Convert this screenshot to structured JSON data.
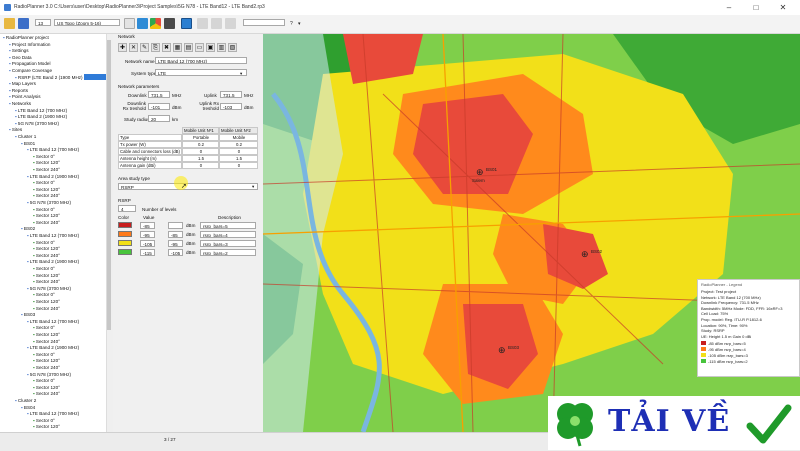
{
  "window": {
    "title": "RadioPlanner 3.0 C:\\Users\\user\\Desktop\\RadioPlanner3\\Project Samples\\5G N78 - LTE Band12 - LTE Band2.rp3"
  },
  "toolbar": {
    "layer_number": "13",
    "basemap": "US Topo (Zoom 5-16)"
  },
  "tree": {
    "items": [
      {
        "label": "RadioPlanner project",
        "indent": 0
      },
      {
        "label": "Project Information",
        "indent": 1
      },
      {
        "label": "Settings",
        "indent": 1
      },
      {
        "label": "Geo Data",
        "indent": 1
      },
      {
        "label": "Propagation Model",
        "indent": 1
      },
      {
        "label": "Compare Coverage",
        "indent": 1
      },
      {
        "label": "RSRP (LTE Band 2 (1900 MHz)",
        "indent": 2
      },
      {
        "label": "Map Layers",
        "indent": 1
      },
      {
        "label": "Reports",
        "indent": 1
      },
      {
        "label": "Point Analysis",
        "indent": 1
      },
      {
        "label": "Networks",
        "indent": 1
      },
      {
        "label": "LTE Band 12 (700 MHz)",
        "indent": 2
      },
      {
        "label": "LTE Band 2 (1900 MHz)",
        "indent": 2
      },
      {
        "label": "5G N78 (3700 MHz)",
        "indent": 2
      },
      {
        "label": "Sites",
        "indent": 1
      },
      {
        "label": "Cluster 1",
        "indent": 2
      },
      {
        "label": "BS01",
        "indent": 3
      },
      {
        "label": "LTE Band 12 (700 MHz)",
        "indent": 4
      },
      {
        "label": "Sector 0°",
        "indent": 5
      },
      {
        "label": "Sector 120°",
        "indent": 5
      },
      {
        "label": "Sector 240°",
        "indent": 5
      },
      {
        "label": "LTE Band 2 (1900 MHz)",
        "indent": 4
      },
      {
        "label": "Sector 0°",
        "indent": 5
      },
      {
        "label": "Sector 120°",
        "indent": 5
      },
      {
        "label": "Sector 240°",
        "indent": 5
      },
      {
        "label": "5G N78 (3700 MHz)",
        "indent": 4
      },
      {
        "label": "Sector 0°",
        "indent": 5
      },
      {
        "label": "Sector 120°",
        "indent": 5
      },
      {
        "label": "Sector 240°",
        "indent": 5
      },
      {
        "label": "BS02",
        "indent": 3
      },
      {
        "label": "LTE Band 12 (700 MHz)",
        "indent": 4
      },
      {
        "label": "Sector 0°",
        "indent": 5
      },
      {
        "label": "Sector 120°",
        "indent": 5
      },
      {
        "label": "Sector 240°",
        "indent": 5
      },
      {
        "label": "LTE Band 2 (1900 MHz)",
        "indent": 4
      },
      {
        "label": "Sector 0°",
        "indent": 5
      },
      {
        "label": "Sector 120°",
        "indent": 5
      },
      {
        "label": "Sector 240°",
        "indent": 5
      },
      {
        "label": "5G N78 (3700 MHz)",
        "indent": 4
      },
      {
        "label": "Sector 0°",
        "indent": 5
      },
      {
        "label": "Sector 120°",
        "indent": 5
      },
      {
        "label": "Sector 240°",
        "indent": 5
      },
      {
        "label": "BS03",
        "indent": 3
      },
      {
        "label": "LTE Band 12 (700 MHz)",
        "indent": 4
      },
      {
        "label": "Sector 0°",
        "indent": 5
      },
      {
        "label": "Sector 120°",
        "indent": 5
      },
      {
        "label": "Sector 240°",
        "indent": 5
      },
      {
        "label": "LTE Band 2 (1900 MHz)",
        "indent": 4
      },
      {
        "label": "Sector 0°",
        "indent": 5
      },
      {
        "label": "Sector 120°",
        "indent": 5
      },
      {
        "label": "Sector 240°",
        "indent": 5
      },
      {
        "label": "5G N78 (3700 MHz)",
        "indent": 4
      },
      {
        "label": "Sector 0°",
        "indent": 5
      },
      {
        "label": "Sector 120°",
        "indent": 5
      },
      {
        "label": "Sector 240°",
        "indent": 5
      },
      {
        "label": "Cluster 2",
        "indent": 2
      },
      {
        "label": "BS04",
        "indent": 3
      },
      {
        "label": "LTE Band 12 (700 MHz)",
        "indent": 4
      },
      {
        "label": "Sector 0°",
        "indent": 5
      },
      {
        "label": "Sector 120°",
        "indent": 5
      }
    ]
  },
  "network": {
    "section": "Network",
    "name_label": "Network name",
    "name_value": "LTE Band 12 (700 MHz)",
    "system_type_label": "System type",
    "system_type_value": "LTE",
    "params_title": "Network parameters",
    "downlink_label": "Downlink",
    "downlink_value": "731.5",
    "downlink_unit": "MHz",
    "uplink_label": "Uplink",
    "uplink_value": "731.5",
    "uplink_unit": "MHz",
    "dl_rx_label": "Downlink Rx treshold",
    "dl_rx_value": "-101",
    "dl_rx_unit": "dBm",
    "ul_rx_label": "Uplink Rx treshold",
    "ul_rx_value": "-103",
    "ul_rx_unit": "dBm",
    "radius_label": "Study radius",
    "radius_value": "20",
    "radius_unit": "km"
  },
  "units_table": {
    "headers": [
      "Type",
      "Mobile Unit Nº1",
      "Mobile Unit Nº2"
    ],
    "rows": [
      [
        "Type",
        "Portable",
        "Mobile"
      ],
      [
        "Tx power (W)",
        "0.2",
        "0.2"
      ],
      [
        "Cable and connectors loss (dB)",
        "0",
        "0"
      ],
      [
        "Antenna height (m)",
        "1.5",
        "1.5"
      ],
      [
        "Antenna gain (dBi)",
        "0",
        "0"
      ]
    ]
  },
  "area_study": {
    "label": "Area study type",
    "value": "RSRP"
  },
  "rsrp": {
    "title": "RSRP",
    "levels_count": "4",
    "levels_label": "Number of levels",
    "col_color": "Color",
    "col_value": "Value",
    "col_description": "Description",
    "rows": [
      {
        "color": "#c81e1e",
        "from": "-85",
        "to": "",
        "unit": "dBm",
        "desc": "rsrp_bars=5"
      },
      {
        "color": "#ff7a1a",
        "from": "-95",
        "to": "-85",
        "unit": "dBm",
        "desc": "rsrp_bars=4"
      },
      {
        "color": "#f2e019",
        "from": "-105",
        "to": "-95",
        "unit": "dBm",
        "desc": "rsrp_bars=3"
      },
      {
        "color": "#48c43c",
        "from": "-115",
        "to": "-105",
        "unit": "dBm",
        "desc": "rsrp_bars=2"
      }
    ]
  },
  "status": {
    "page": "3 / 27"
  },
  "legend": {
    "title": "RadioPlanner - Legend",
    "lines": [
      "Project: Test project",
      "Network: LTE Band 12 (700 MHz)",
      "Downlink Frequency: 731.5 MHz",
      "Bandwidth: 5MHz Mode: FDD, FFR: 16xRF=3",
      "Cell Load: 75%",
      "Prop. model: Reg. ITU-R P.1812-6",
      "Location: 90%, Time: 90%",
      "Study: RSRP",
      "UE: Height 1.5 m Gain 0 dBi"
    ],
    "entries": [
      {
        "color": "#c81e1e",
        "label": "-85 dBm rsrp_bars=5"
      },
      {
        "color": "#ff7a1a",
        "label": "-95 dBm rsrp_bars=4"
      },
      {
        "color": "#f2e019",
        "label": "-105 dBm rsrp_bars=3"
      },
      {
        "color": "#48c43c",
        "label": "-115 dBm rsrp_bars=2"
      }
    ]
  },
  "map": {
    "sites": [
      {
        "label": "BS01"
      },
      {
        "label": "BS02"
      },
      {
        "label": "BS03"
      }
    ],
    "place": "Salem"
  },
  "watermark": {
    "text": "TẢI VỀ"
  }
}
